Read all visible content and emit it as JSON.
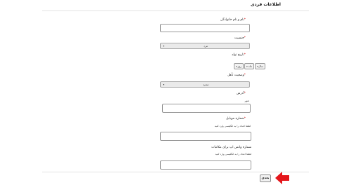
{
  "section": {
    "title": "اطلاعات فردی"
  },
  "fields": {
    "full_name": {
      "label": "نام و نام خانوادگی",
      "required": "*",
      "value": ""
    },
    "gender": {
      "label": "جنسیت",
      "required": "*",
      "value": "مرد",
      "icon": "chevron-down-icon"
    },
    "birth_date": {
      "label": "تاریخ تولد",
      "required": "*",
      "year": "سال",
      "month": "ماه",
      "day": "روز"
    },
    "marital_status": {
      "label": "وضعیت تأهل",
      "required": "*",
      "value": "مجرد"
    },
    "address": {
      "label": "آدرس",
      "required": "*",
      "sublabel": "شهر",
      "value": ""
    },
    "mobile": {
      "label": "شماره موبایل",
      "required": "*",
      "hint": "لطفا اعداد را به انگلیسی وارد کنید",
      "value": ""
    },
    "whatsapp": {
      "label": "شماره واتس اپ برای مکاتبات",
      "hint": "لطفا اعداد را به انگلیسی وارد کنید",
      "value": ""
    }
  },
  "actions": {
    "next_label": "بعدی"
  },
  "colors": {
    "arrow": "#e4161b",
    "required": "#cc0000"
  }
}
